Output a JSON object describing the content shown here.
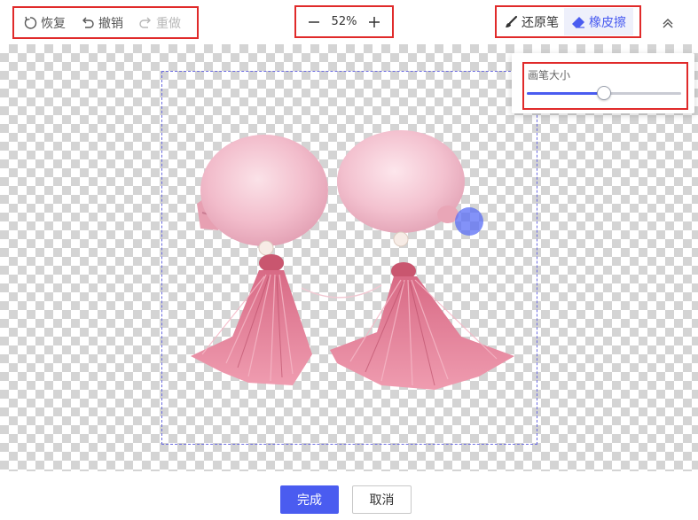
{
  "toolbar": {
    "history": {
      "restore": {
        "label": "恢复",
        "icon": "rotate-ccw-icon"
      },
      "undo": {
        "label": "撤销",
        "icon": "undo-arrow-icon"
      },
      "redo": {
        "label": "重做",
        "icon": "redo-arrow-icon",
        "disabled": true
      }
    },
    "zoom": {
      "value": "52%",
      "minus_icon": "minus-icon",
      "plus_icon": "plus-icon"
    },
    "tools": {
      "restore_brush": {
        "label": "还原笔",
        "icon": "brush-icon"
      },
      "eraser": {
        "label": "橡皮擦",
        "icon": "eraser-icon",
        "active": true
      }
    },
    "collapse_icon": "chevron-double-up-icon"
  },
  "brush_popup": {
    "label": "画笔大小",
    "brush_size": 0.5
  },
  "footer": {
    "confirm_label": "完成",
    "cancel_label": "取消"
  },
  "colors": {
    "accent": "#4a5cf0",
    "highlight_border": "#e02a2a",
    "checker": "#d4d4d4"
  }
}
